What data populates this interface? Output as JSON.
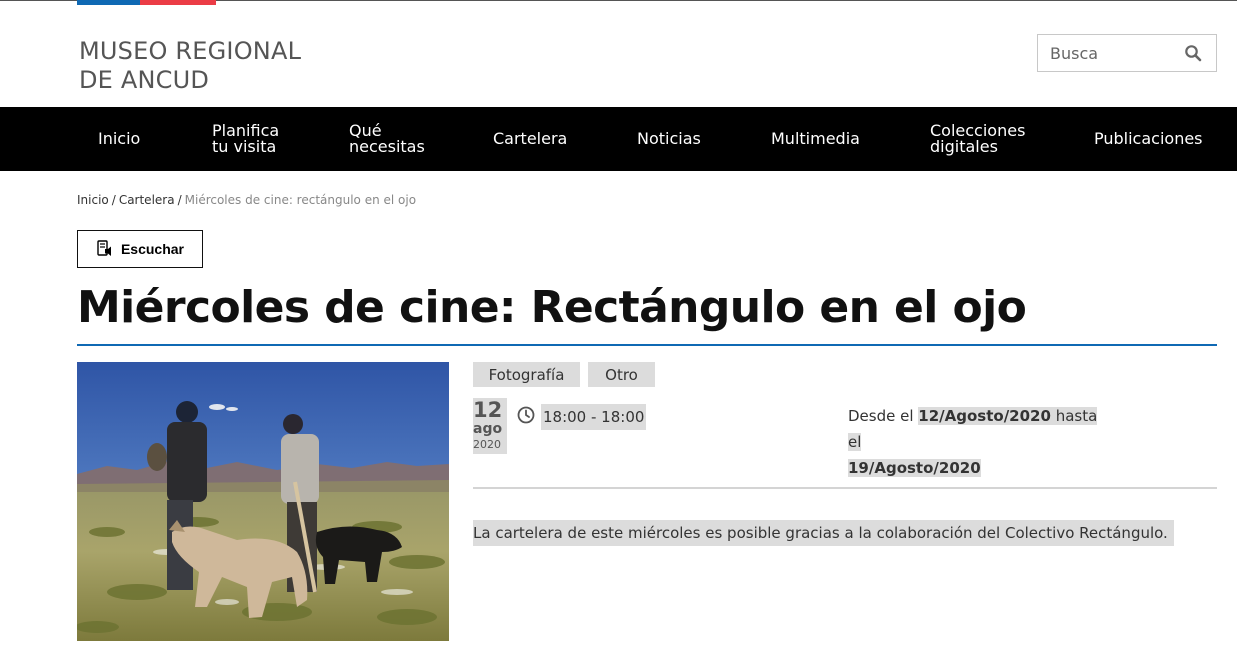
{
  "header": {
    "logo_line1": "MUSEO REGIONAL",
    "logo_line2": "DE ANCUD",
    "search_placeholder": "Busca"
  },
  "nav": {
    "items": [
      {
        "line1": "Inicio",
        "line2": ""
      },
      {
        "line1": "Planifica",
        "line2": "tu visita"
      },
      {
        "line1": "Qué",
        "line2": "necesitas"
      },
      {
        "line1": "Cartelera",
        "line2": ""
      },
      {
        "line1": "Noticias",
        "line2": ""
      },
      {
        "line1": "Multimedia",
        "line2": ""
      },
      {
        "line1": "Colecciones",
        "line2": "digitales"
      },
      {
        "line1": "Publicaciones",
        "line2": ""
      }
    ]
  },
  "breadcrumb": {
    "home": "Inicio",
    "section": "Cartelera",
    "current": "Miércoles de cine: rectángulo en el ojo",
    "separator": "/"
  },
  "listen_button": "Escuchar",
  "article": {
    "title": "Miércoles de cine: Rectángulo en el ojo",
    "tags": [
      "Fotografía",
      "Otro"
    ],
    "date_day": "12",
    "date_month": "ago",
    "date_year": "2020",
    "time": "18:00 - 18:00",
    "range_from_label": "Desde el",
    "range_from": "12/Agosto/2020",
    "range_to_label": "hasta el",
    "range_to": "19/Agosto/2020",
    "description": "La cartelera de este miércoles es posible gracias a la colaboración del Colectivo Rectángulo."
  },
  "colors": {
    "nav_bg": "#000000",
    "accent_blue": "#0f69b4",
    "accent_red": "#eb3c46",
    "highlight": "#dcdcdc"
  },
  "icons": {
    "search": "search-icon",
    "listen": "speaker-icon",
    "time": "clock-icon"
  }
}
